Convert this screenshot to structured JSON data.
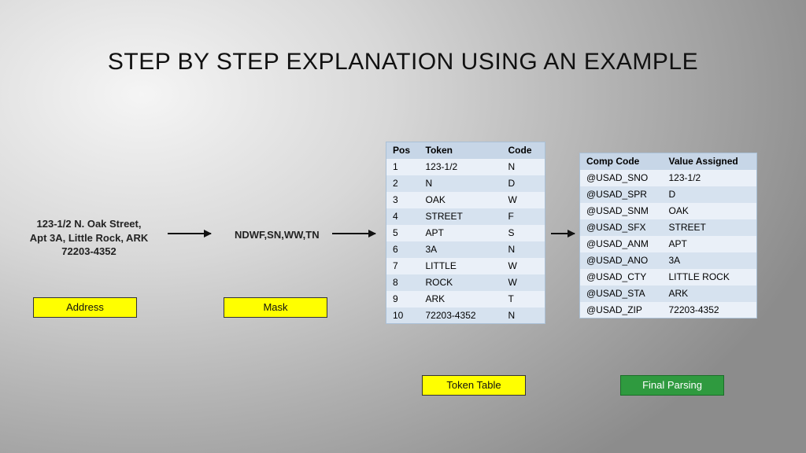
{
  "title": "STEP BY STEP EXPLANATION USING AN EXAMPLE",
  "address": {
    "line1": "123-1/2 N. Oak Street,",
    "line2": "Apt 3A, Little Rock, ARK",
    "line3": "72203-4352"
  },
  "mask": "NDWF,SN,WW,TN",
  "labels": {
    "address": "Address",
    "mask": "Mask",
    "token_table": "Token Table",
    "final": "Final Parsing"
  },
  "token_table": {
    "headers": [
      "Pos",
      "Token",
      "Code"
    ],
    "rows": [
      [
        "1",
        "123-1/2",
        "N"
      ],
      [
        "2",
        "N",
        "D"
      ],
      [
        "3",
        "OAK",
        "W"
      ],
      [
        "4",
        "STREET",
        "F"
      ],
      [
        "5",
        "APT",
        "S"
      ],
      [
        "6",
        "3A",
        "N"
      ],
      [
        "7",
        "LITTLE",
        "W"
      ],
      [
        "8",
        "ROCK",
        "W"
      ],
      [
        "9",
        "ARK",
        "T"
      ],
      [
        "10",
        "72203-4352",
        "N"
      ]
    ]
  },
  "final_table": {
    "headers": [
      "Comp Code",
      "Value Assigned"
    ],
    "rows": [
      [
        "@USAD_SNO",
        "123-1/2"
      ],
      [
        "@USAD_SPR",
        "D"
      ],
      [
        "@USAD_SNM",
        "OAK"
      ],
      [
        "@USAD_SFX",
        "STREET"
      ],
      [
        "@USAD_ANM",
        "APT"
      ],
      [
        "@USAD_ANO",
        "3A"
      ],
      [
        "@USAD_CTY",
        "LITTLE ROCK"
      ],
      [
        "@USAD_STA",
        "ARK"
      ],
      [
        "@USAD_ZIP",
        "72203-4352"
      ]
    ]
  }
}
